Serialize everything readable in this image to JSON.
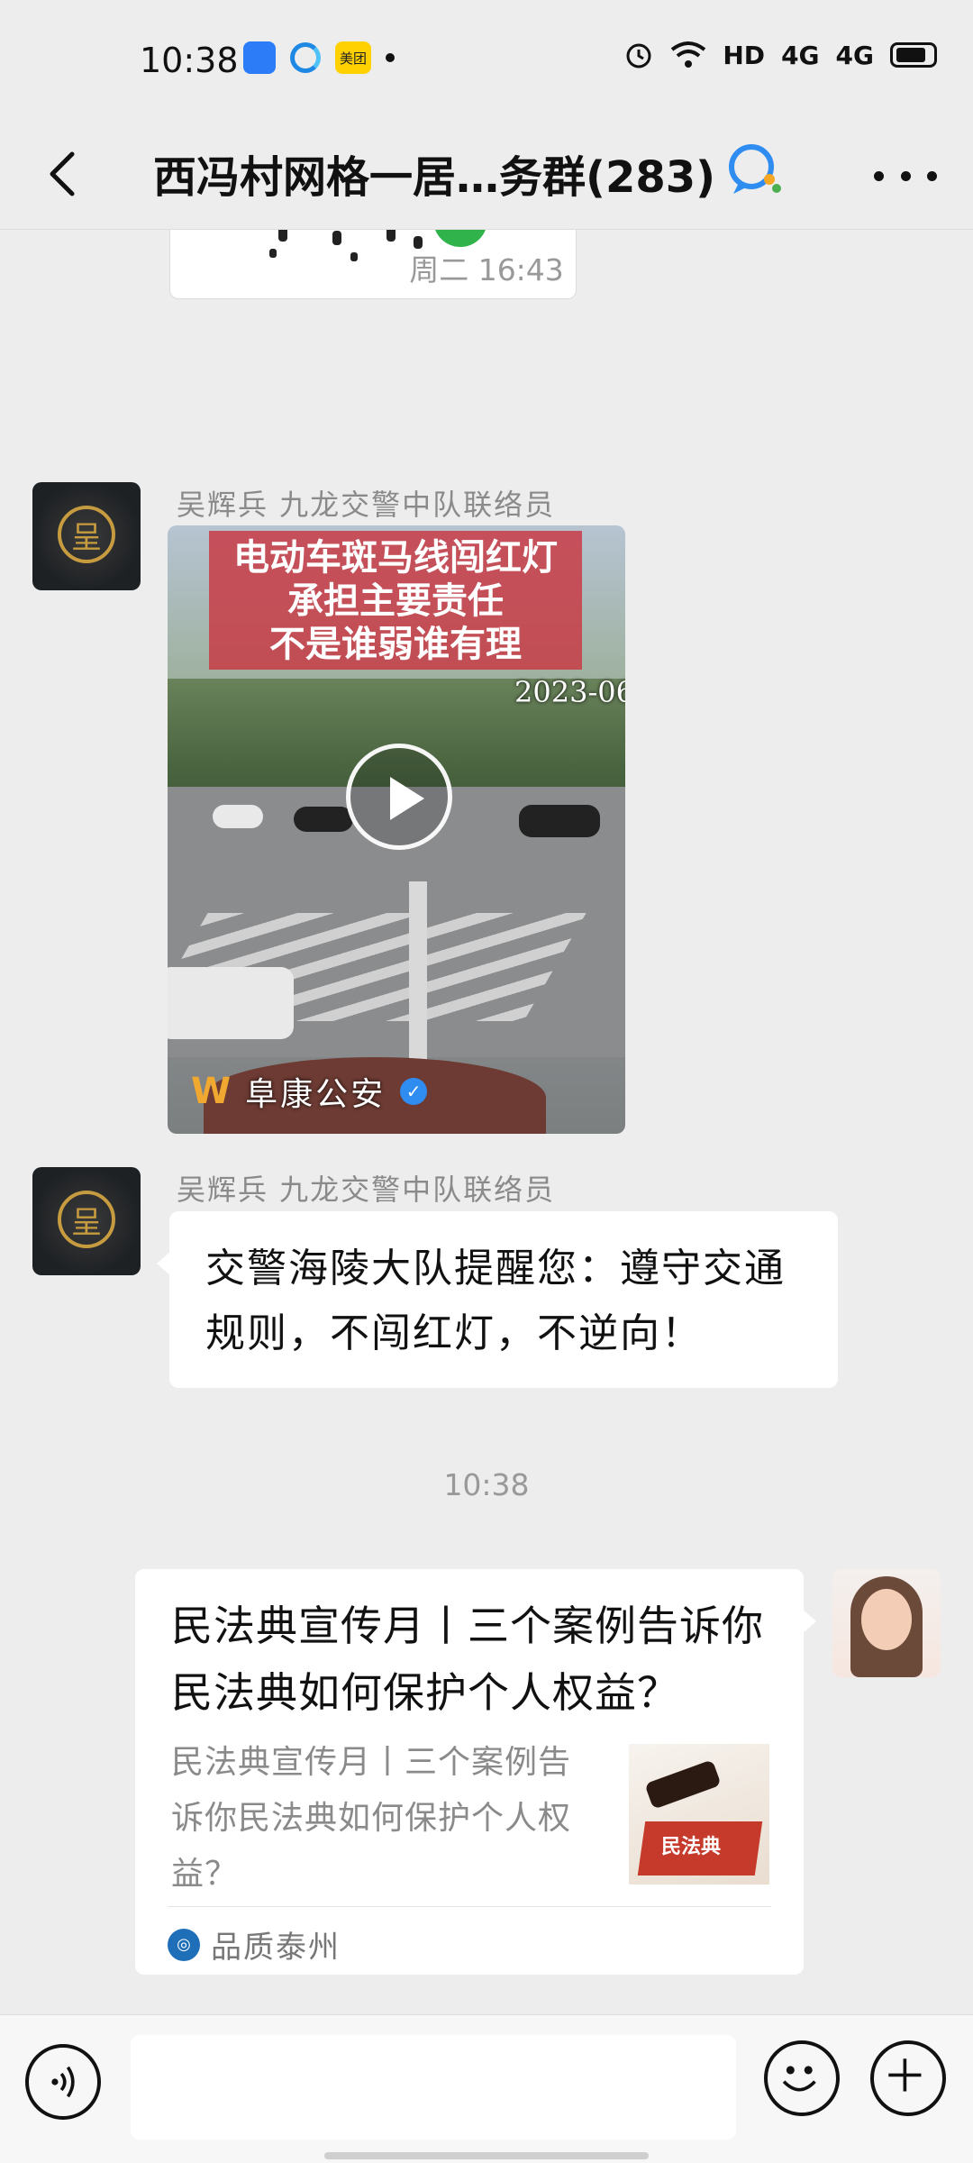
{
  "status_bar": {
    "time": "10:38",
    "meituan_label": "美团",
    "network_label": "HD",
    "signal_1": "4G",
    "signal_2": "4G"
  },
  "header": {
    "title": "西冯村网格一居…务群(283)"
  },
  "messages": {
    "timestamp_1": "周二 16:43",
    "sender_1": "吴辉兵  九龙交警中队联络员",
    "video": {
      "banner_line_1": "电动车斑马线闯红灯",
      "banner_line_2": "承担主要责任",
      "banner_line_3": "不是谁弱谁有理",
      "date_overlay": "2023-06",
      "source_name": "阜康公安"
    },
    "sender_2": "吴辉兵  九龙交警中队联络员",
    "text_1": "交警海陵大队提醒您：遵守交通规则，不闯红灯，不逆向！",
    "timestamp_2": "10:38",
    "article": {
      "title": "民法典宣传月丨三个案例告诉你民法典如何保护个人权益？",
      "description": "民法典宣传月丨三个案例告诉你民法典如何保护个人权益？",
      "thumb_text": "民法典",
      "source": "品质泰州"
    }
  },
  "icons": {
    "back": "chevron-left-icon",
    "more": "more-icon",
    "voice": "voice-icon",
    "emoji": "emoji-icon",
    "plus": "plus-icon"
  }
}
